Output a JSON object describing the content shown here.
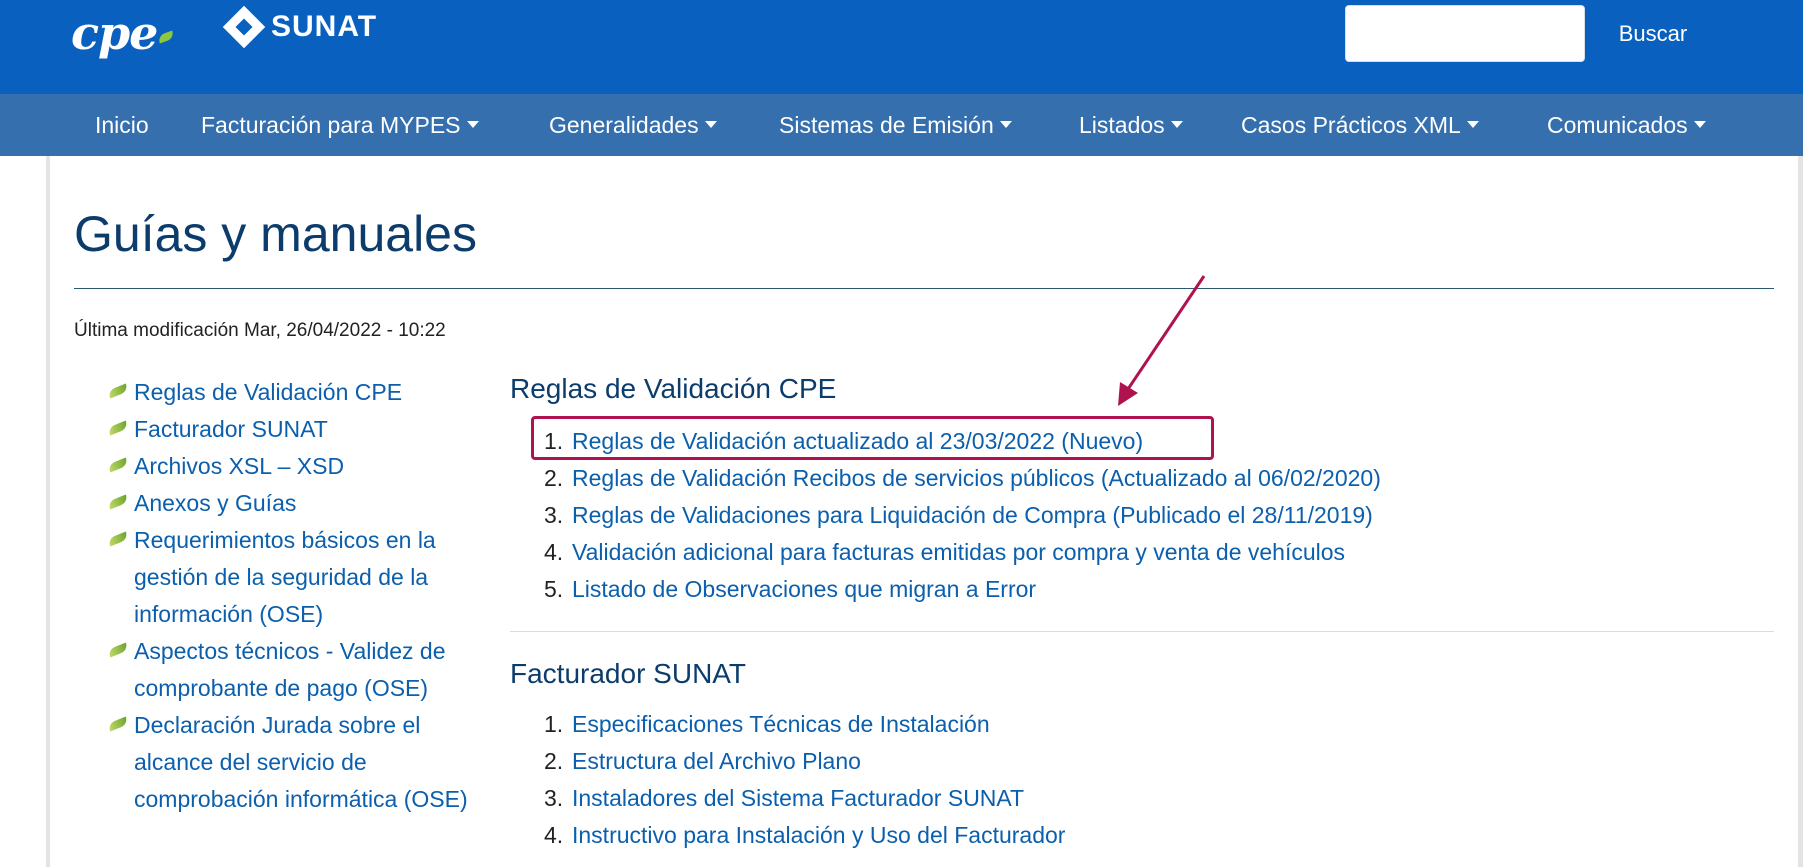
{
  "header": {
    "logo_cpe_text": "cpe",
    "logo_sunat_text": "SUNAT",
    "search_placeholder": "",
    "search_button_label": "Buscar",
    "brand_color": "#0a60bf"
  },
  "nav": {
    "items": [
      {
        "label": "Inicio",
        "dropdown": false
      },
      {
        "label": "Facturación para MYPES",
        "dropdown": true
      },
      {
        "label": "Generalidades",
        "dropdown": true
      },
      {
        "label": "Sistemas de Emisión",
        "dropdown": true
      },
      {
        "label": "Listados",
        "dropdown": true
      },
      {
        "label": "Casos Prácticos XML",
        "dropdown": true
      },
      {
        "label": "Comunicados",
        "dropdown": true
      }
    ]
  },
  "page": {
    "title": "Guías y manuales",
    "last_modified": "Última modificación Mar, 26/04/2022 - 10:22"
  },
  "sidebar": {
    "items": [
      {
        "label": "Reglas de Validación CPE"
      },
      {
        "label": "Facturador SUNAT"
      },
      {
        "label": "Archivos XSL – XSD"
      },
      {
        "label": "Anexos y Guías"
      },
      {
        "label": "Requerimientos básicos en la gestión de la seguridad de la información (OSE)"
      },
      {
        "label": "Aspectos técnicos - Validez de comprobante de pago (OSE)"
      },
      {
        "label": "Declaración Jurada sobre el alcance del servicio de comprobación informática (OSE)"
      }
    ]
  },
  "sections": [
    {
      "heading": "Reglas de Validación CPE",
      "items": [
        {
          "num": "1.",
          "label": "Reglas de Validación actualizado al 23/03/2022 (Nuevo)",
          "highlighted": true
        },
        {
          "num": "2.",
          "label": "Reglas de Validación Recibos de servicios públicos (Actualizado al 06/02/2020)"
        },
        {
          "num": "3.",
          "label": "Reglas de Validaciones para Liquidación de Compra (Publicado el 28/11/2019)"
        },
        {
          "num": "4.",
          "label": "Validación adicional para facturas emitidas por compra y venta de vehículos"
        },
        {
          "num": "5.",
          "label": "Listado de Observaciones que migran a Error"
        }
      ]
    },
    {
      "heading": "Facturador SUNAT",
      "items": [
        {
          "num": "1.",
          "label": "Especificaciones Técnicas de Instalación"
        },
        {
          "num": "2.",
          "label": "Estructura del Archivo Plano"
        },
        {
          "num": "3.",
          "label": "Instaladores del Sistema Facturador SUNAT"
        },
        {
          "num": "4.",
          "label": "Instructivo para Instalación y Uso del Facturador"
        }
      ]
    }
  ],
  "annotation": {
    "color": "#b0124f"
  }
}
